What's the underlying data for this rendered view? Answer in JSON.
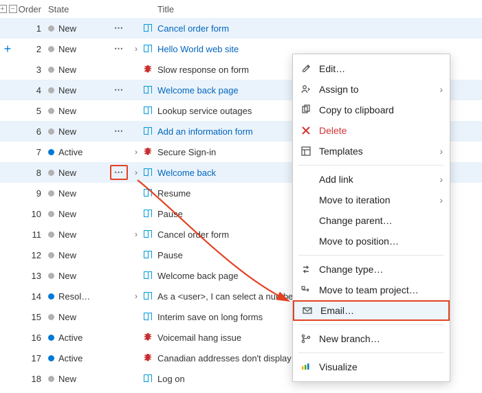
{
  "header": {
    "order": "Order",
    "state": "State",
    "title": "Title"
  },
  "state_labels": {
    "new": "New",
    "active": "Active",
    "resolved": "Resol…"
  },
  "rows": [
    {
      "order": 1,
      "state": "new",
      "title": "Cancel order form",
      "kind": "book",
      "link": true,
      "more": true,
      "expand": false,
      "sel": true
    },
    {
      "order": 2,
      "state": "new",
      "title": "Hello World web site",
      "kind": "book",
      "link": true,
      "more": true,
      "expand": true,
      "add": true
    },
    {
      "order": 3,
      "state": "new",
      "title": "Slow response on form",
      "kind": "bug",
      "link": false
    },
    {
      "order": 4,
      "state": "new",
      "title": "Welcome back page",
      "kind": "book",
      "link": true,
      "more": true,
      "sel": true
    },
    {
      "order": 5,
      "state": "new",
      "title": "Lookup service outages",
      "kind": "book",
      "link": false
    },
    {
      "order": 6,
      "state": "new",
      "title": "Add an information form",
      "kind": "book",
      "link": true,
      "more": true,
      "sel": true
    },
    {
      "order": 7,
      "state": "active",
      "title": "Secure Sign-in",
      "kind": "bug",
      "link": false,
      "expand": true
    },
    {
      "order": 8,
      "state": "new",
      "title": "Welcome back",
      "kind": "book",
      "link": true,
      "more": true,
      "more_boxed": true,
      "expand": true,
      "sel": true
    },
    {
      "order": 9,
      "state": "new",
      "title": "Resume",
      "kind": "book",
      "link": false
    },
    {
      "order": 10,
      "state": "new",
      "title": "Pause",
      "kind": "book",
      "link": false
    },
    {
      "order": 11,
      "state": "new",
      "title": "Cancel order form",
      "kind": "book",
      "link": false,
      "expand": true
    },
    {
      "order": 12,
      "state": "new",
      "title": "Pause",
      "kind": "book",
      "link": false
    },
    {
      "order": 13,
      "state": "new",
      "title": "Welcome back page",
      "kind": "book",
      "link": false
    },
    {
      "order": 14,
      "state": "resolved",
      "title": "As a <user>, I can select a numbe",
      "kind": "book",
      "link": false,
      "expand": true
    },
    {
      "order": 15,
      "state": "new",
      "title": "Interim save on long forms",
      "kind": "book",
      "link": false
    },
    {
      "order": 16,
      "state": "active",
      "title": "Voicemail hang issue",
      "kind": "bug",
      "link": false
    },
    {
      "order": 17,
      "state": "active",
      "title": "Canadian addresses don't display",
      "kind": "bug",
      "link": false
    },
    {
      "order": 18,
      "state": "new",
      "title": "Log on",
      "kind": "book",
      "link": false
    }
  ],
  "menu": {
    "groups": [
      [
        {
          "icon": "edit",
          "label": "Edit…"
        },
        {
          "icon": "assign",
          "label": "Assign to",
          "sub": true
        },
        {
          "icon": "copy",
          "label": "Copy to clipboard"
        },
        {
          "icon": "delete",
          "label": "Delete",
          "danger": true
        },
        {
          "icon": "template",
          "label": "Templates",
          "sub": true
        }
      ],
      [
        {
          "icon": "",
          "label": "Add link",
          "sub": true
        },
        {
          "icon": "",
          "label": "Move to iteration",
          "sub": true
        },
        {
          "icon": "",
          "label": "Change parent…"
        },
        {
          "icon": "",
          "label": "Move to position…"
        }
      ],
      [
        {
          "icon": "change",
          "label": "Change type…"
        },
        {
          "icon": "move",
          "label": "Move to team project…"
        },
        {
          "icon": "email",
          "label": "Email…",
          "highlight": true,
          "redbox": true
        }
      ],
      [
        {
          "icon": "branch",
          "label": "New branch…"
        }
      ],
      [
        {
          "icon": "viz",
          "label": "Visualize"
        }
      ]
    ]
  },
  "colors": {
    "book": "#0099d8",
    "bug": "#c92f2f",
    "link": "#0066bf",
    "accent": "#0078d4",
    "callout": "#e34224"
  }
}
